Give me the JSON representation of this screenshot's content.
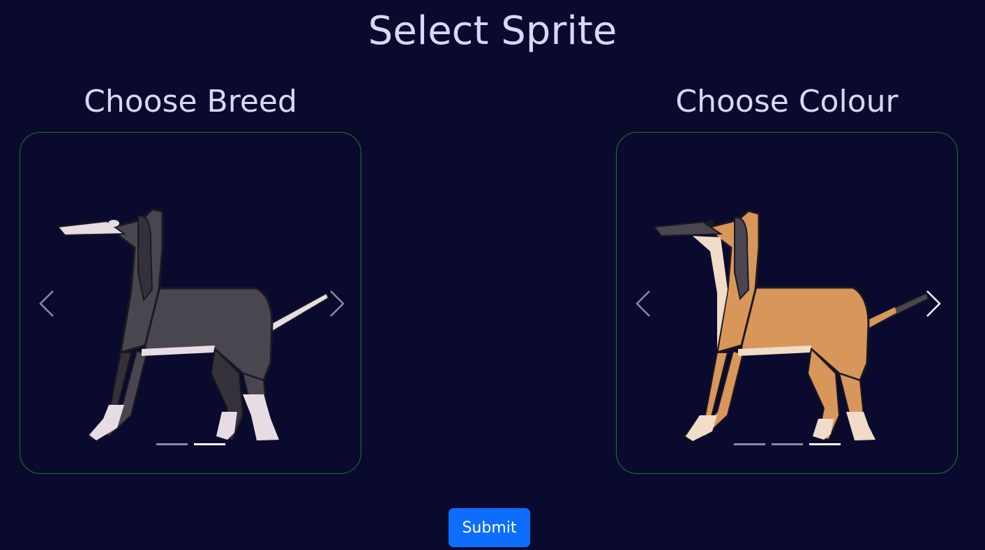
{
  "page": {
    "title": "Select Sprite"
  },
  "breed": {
    "title": "Choose Breed",
    "indicator_count": 2,
    "active_index": 1,
    "colors": {
      "body": "#4a4650",
      "dark": "#34313b",
      "light": "#e8dce4",
      "outline": "#1a1820"
    }
  },
  "colour": {
    "title": "Choose Colour",
    "indicator_count": 3,
    "active_index": 2,
    "colors": {
      "body": "#d9965a",
      "dark": "#4a4650",
      "light": "#f0dcc8",
      "outline": "#1a1820"
    }
  },
  "submit": {
    "label": "Submit"
  }
}
